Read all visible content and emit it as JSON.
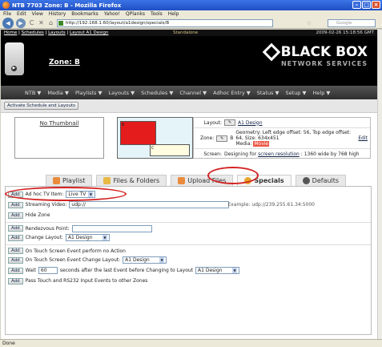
{
  "window": {
    "title": "NTB 7703 Zone: B - Mozilla Firefox"
  },
  "menu": [
    "File",
    "Edit",
    "View",
    "History",
    "Bookmarks",
    "Yahoo!",
    "QPlanks",
    "Tools",
    "Help"
  ],
  "nav": {
    "url": "http://192.168.1.60/layout/a1design/specials/B",
    "search_placeholder": "Google"
  },
  "topstrip": {
    "home": "Home",
    "schedules": "Schedules",
    "layouts": "Layouts",
    "layout_name": "Layout A1 Design",
    "mode": "Standalone",
    "clock": "2009-02-26 15:18:56 GMT"
  },
  "header": {
    "zone_title": "Zone: B",
    "logo_main": "BLACK BOX",
    "logo_sub": "NETWORK SERVICES"
  },
  "main_menu": [
    "NTB ▼",
    "Media ▼",
    "Playlists ▼",
    "Layouts ▼",
    "Schedules ▼",
    "Channel ▼",
    "Adhoc Entry ▼",
    "Status ▼",
    "Setup ▼",
    "Help ▼"
  ],
  "action_button": "Activate Schedule and Layouts",
  "preview": {
    "thumbnail": "No Thumbnail",
    "zone_b": "B",
    "zone_c": "C"
  },
  "info": {
    "layout_label": "Layout:",
    "layout_value": "A1 Design",
    "zone_label": "Zone:",
    "zone_letter": "B",
    "zone_geometry": "Geometry: Left edge offset: 56, Top edge offset: 64, Size: 634x451",
    "media_label": "Media:",
    "media_value": "Movie",
    "edit": "Edit",
    "screen_label": "Screen:",
    "screen_text_pre": "Designing for",
    "screen_link": "screen resolution",
    "screen_text_post": ": 1360 wide by 768 high"
  },
  "tabs": [
    "Playlist",
    "Files & Folders",
    "Upload Files",
    "Specials",
    "Defaults"
  ],
  "specials": {
    "add": "Add",
    "adhoc_label": "Ad hoc TV Item:",
    "adhoc_value": "Live TV",
    "streaming_label": "Streaming Video:",
    "streaming_value": "udp://",
    "streaming_example": "Example: udp://239.255.61.34:5000",
    "hide_zone": "Hide Zone",
    "rendezvous": "Rendezvous Point:",
    "change_layout": "Change Layout:",
    "change_layout_value": "A1 Design",
    "touch_no_action": "On Touch Screen Event perform no Action",
    "touch_change_layout": "On Touch Screen Event Change Layout:",
    "touch_change_value": "A1 Design",
    "wait_pre": "Wait",
    "wait_value": "60",
    "wait_post": "seconds after the last Event before Changing to Layout",
    "wait_layout_value": "A1 Design",
    "pass_touch": "Pass Touch and RS232 Input Events to other Zones"
  },
  "status": "Done"
}
